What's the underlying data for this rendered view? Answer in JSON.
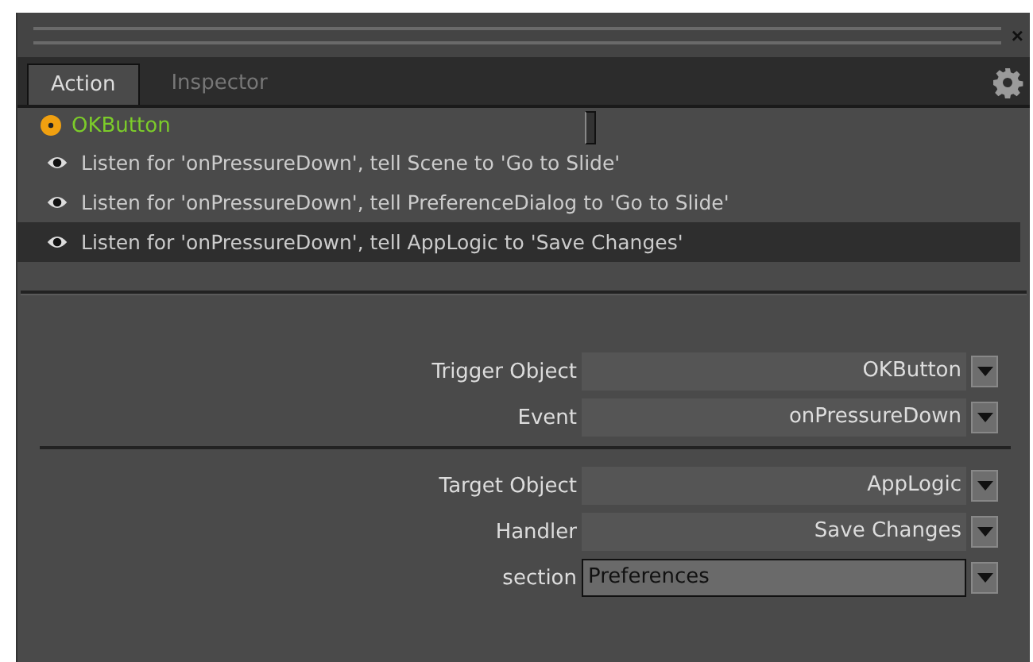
{
  "window": {
    "close": "×"
  },
  "tabs": [
    {
      "label": "Action",
      "selected": true
    },
    {
      "label": "Inspector",
      "selected": false
    }
  ],
  "object": {
    "name": "OKButton"
  },
  "listeners": [
    {
      "text": "Listen for 'onPressureDown', tell Scene to 'Go to Slide'",
      "selected": false
    },
    {
      "text": "Listen for 'onPressureDown', tell PreferenceDialog to 'Go to Slide'",
      "selected": false
    },
    {
      "text": "Listen for 'onPressureDown', tell AppLogic to 'Save Changes'",
      "selected": true
    }
  ],
  "groups": [
    [
      {
        "label": "Trigger Object",
        "value": "OKButton",
        "kind": "select"
      },
      {
        "label": "Event",
        "value": "onPressureDown",
        "kind": "select"
      }
    ],
    [
      {
        "label": "Target Object",
        "value": "AppLogic",
        "kind": "select"
      },
      {
        "label": "Handler",
        "value": "Save Changes",
        "kind": "select"
      },
      {
        "label": "section",
        "value": "Preferences",
        "kind": "text"
      }
    ]
  ]
}
